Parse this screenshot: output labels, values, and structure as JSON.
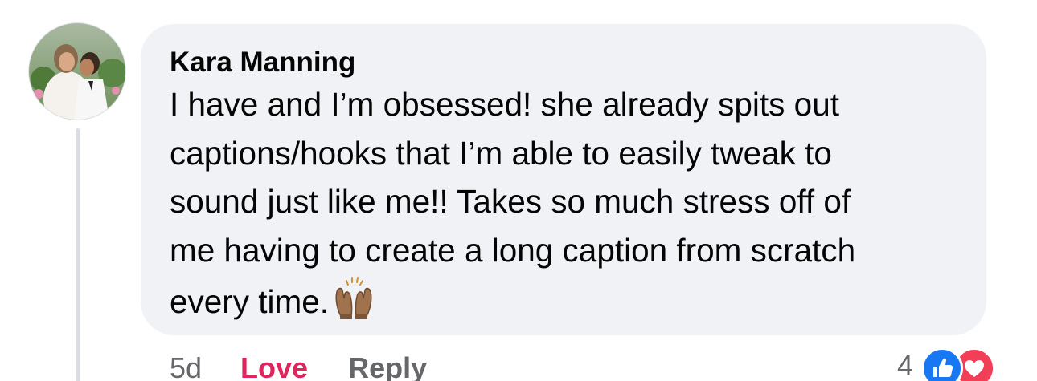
{
  "comment": {
    "author": "Kara Manning",
    "body_lines": [
      "I have and I’m obsessed! she already spits out",
      "captions/hooks that I’m able to easily tweak to",
      "sound just like me!! Takes so much stress off of",
      "me having to create a long caption from scratch",
      "every time."
    ],
    "emoji": "raising-hands-emoji",
    "timestamp": "5d",
    "love_label": "Love",
    "reply_label": "Reply",
    "reaction_count": "4",
    "reaction_icons": [
      "like-icon",
      "heart-icon"
    ]
  },
  "colors": {
    "bubble_bg": "#f0f2f5",
    "love_active": "#e0245e",
    "meta_gray": "#65676b",
    "like_blue": "#1877f2",
    "heart_red": "#f33e58"
  }
}
